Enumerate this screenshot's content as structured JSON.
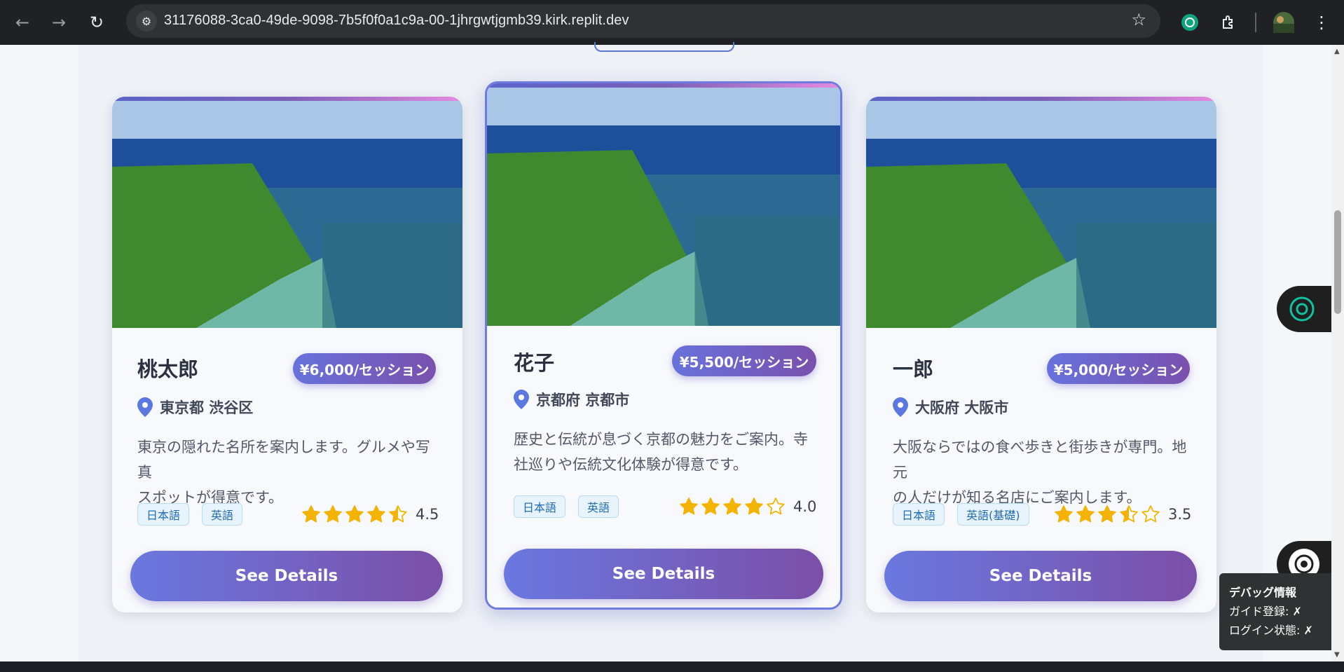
{
  "browser": {
    "url": "31176088-3ca0-49de-9098-7b5f0f0a1c9a-00-1jhrgwtjgmb39.kirk.replit.dev"
  },
  "guides": [
    {
      "name": "桃太郎",
      "price": "¥6,000/セッション",
      "location": "東京都 渋谷区",
      "description_line1": "東京の隠れた名所を案内します。グルメや写真",
      "description_line2": "スポットが得意です。",
      "languages": [
        "日本語",
        "英語"
      ],
      "rating": 4.5,
      "rating_label": "4.5",
      "button": "See Details"
    },
    {
      "name": "花子",
      "price": "¥5,500/セッション",
      "location": "京都府 京都市",
      "description_line1": "歴史と伝統が息づく京都の魅力をご案内。寺",
      "description_line2": "社巡りや伝統文化体験が得意です。",
      "languages": [
        "日本語",
        "英語"
      ],
      "rating": 4.0,
      "rating_label": "4.0",
      "button": "See Details"
    },
    {
      "name": "一郎",
      "price": "¥5,000/セッション",
      "location": "大阪府 大阪市",
      "description_line1": "大阪ならではの食べ歩きと街歩きが専門。地元",
      "description_line2": "の人だけが知る名店にご案内します。",
      "languages": [
        "日本語",
        "英語(基礎)"
      ],
      "rating": 3.5,
      "rating_label": "3.5",
      "button": "See Details"
    }
  ],
  "debug": {
    "title": "デバッグ情報",
    "guide_registered": "ガイド登録: ✗",
    "login_status": "ログイン状態: ✗"
  },
  "colors": {
    "accent": "#6a78e0",
    "accent_end": "#7b4fa7",
    "star": "#f5b301",
    "pin": "#5b78e0"
  }
}
